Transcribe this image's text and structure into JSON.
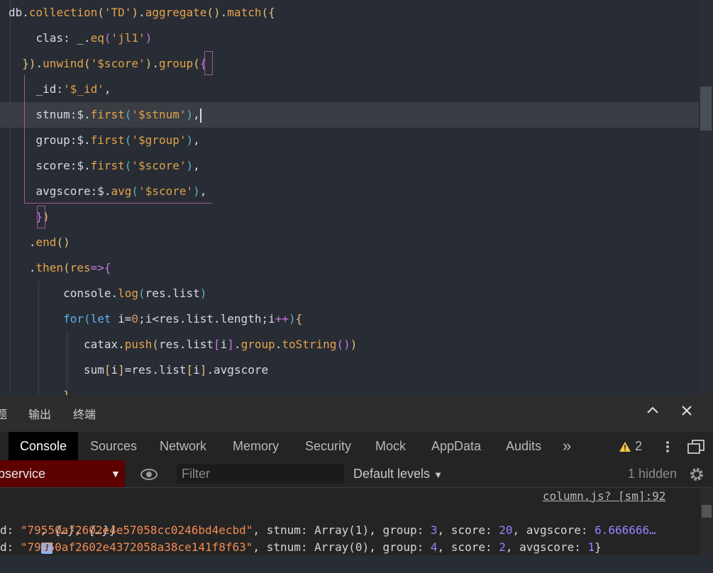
{
  "editor": {
    "lines": [
      [
        [
          "t-plain",
          "db."
        ],
        [
          "t-fn",
          "collection"
        ],
        [
          "t-br1",
          "("
        ],
        [
          "t-str",
          "'TD'"
        ],
        [
          "t-br1",
          ")"
        ],
        [
          "t-plain",
          "."
        ],
        [
          "t-fn",
          "aggregate"
        ],
        [
          "t-br1",
          "()"
        ],
        [
          "t-plain",
          "."
        ],
        [
          "t-fn",
          "match"
        ],
        [
          "t-br1",
          "({"
        ]
      ],
      [
        [
          "t-plain",
          "    clas: _."
        ],
        [
          "t-fn",
          "eq"
        ],
        [
          "t-br2",
          "("
        ],
        [
          "t-str",
          "'jl1'"
        ],
        [
          "t-br2",
          ")"
        ]
      ],
      [
        [
          "t-plain",
          "  "
        ],
        [
          "t-br1",
          "})"
        ],
        [
          "t-plain",
          "."
        ],
        [
          "t-fn",
          "unwind"
        ],
        [
          "t-br1",
          "("
        ],
        [
          "t-str",
          "'$score'"
        ],
        [
          "t-br1",
          ")"
        ],
        [
          "t-plain",
          "."
        ],
        [
          "t-fn",
          "group"
        ],
        [
          "t-br1",
          "("
        ],
        [
          "t-br2",
          "{"
        ]
      ],
      [
        [
          "t-plain",
          "    _id:"
        ],
        [
          "t-str",
          "'$_id'"
        ],
        [
          "t-plain",
          ","
        ]
      ],
      [
        [
          "t-plain",
          "    stnum:$."
        ],
        [
          "t-fn",
          "first"
        ],
        [
          "t-br3",
          "("
        ],
        [
          "t-str",
          "'$stnum'"
        ],
        [
          "t-br3",
          ")"
        ],
        [
          "t-plain",
          ","
        ]
      ],
      [
        [
          "t-plain",
          "    group:$."
        ],
        [
          "t-fn",
          "first"
        ],
        [
          "t-br3",
          "("
        ],
        [
          "t-str",
          "'$group'"
        ],
        [
          "t-br3",
          ")"
        ],
        [
          "t-plain",
          ","
        ]
      ],
      [
        [
          "t-plain",
          "    score:$."
        ],
        [
          "t-fn",
          "first"
        ],
        [
          "t-br3",
          "("
        ],
        [
          "t-str",
          "'$score'"
        ],
        [
          "t-br3",
          ")"
        ],
        [
          "t-plain",
          ","
        ]
      ],
      [
        [
          "t-plain",
          "    avgscore:$."
        ],
        [
          "t-fn",
          "avg"
        ],
        [
          "t-br3",
          "("
        ],
        [
          "t-str",
          "'$score'"
        ],
        [
          "t-br3",
          ")"
        ],
        [
          "t-plain",
          ","
        ]
      ],
      [
        [
          "t-plain",
          "    "
        ],
        [
          "t-br2",
          "}"
        ],
        [
          "t-br1",
          ")"
        ]
      ],
      [
        [
          "t-plain",
          "   ."
        ],
        [
          "t-fn",
          "end"
        ],
        [
          "t-br1",
          "()"
        ]
      ],
      [
        [
          "t-plain",
          "   ."
        ],
        [
          "t-fn",
          "then"
        ],
        [
          "t-br1",
          "("
        ],
        [
          "t-fn",
          "res"
        ],
        [
          "t-pink",
          "=>"
        ],
        [
          "t-br2",
          "{"
        ]
      ],
      [
        [
          "t-plain",
          "        console."
        ],
        [
          "t-fn",
          "log"
        ],
        [
          "t-br3",
          "("
        ],
        [
          "t-plain",
          "res.list"
        ],
        [
          "t-br3",
          ")"
        ]
      ],
      [
        [
          "t-plain",
          "        "
        ],
        [
          "t-kw",
          "for"
        ],
        [
          "t-br3",
          "("
        ],
        [
          "t-kw",
          "let"
        ],
        [
          "t-plain",
          " i="
        ],
        [
          "t-num",
          "0"
        ],
        [
          "t-plain",
          ";i<res.list.length;i"
        ],
        [
          "t-pink",
          "++"
        ],
        [
          "t-br3",
          ")"
        ],
        [
          "t-br1",
          "{"
        ]
      ],
      [
        [
          "t-plain",
          "           catax."
        ],
        [
          "t-fn",
          "push"
        ],
        [
          "t-br1",
          "("
        ],
        [
          "t-plain",
          "res.list"
        ],
        [
          "t-br2",
          "["
        ],
        [
          "t-plain",
          "i"
        ],
        [
          "t-br2",
          "]"
        ],
        [
          "t-plain",
          "."
        ],
        [
          "t-fn",
          "group"
        ],
        [
          "t-plain",
          "."
        ],
        [
          "t-fn",
          "toString"
        ],
        [
          "t-br2",
          "()"
        ],
        [
          "t-br1",
          ")"
        ]
      ],
      [
        [
          "t-plain",
          "           sum"
        ],
        [
          "t-br1",
          "["
        ],
        [
          "t-plain",
          "i"
        ],
        [
          "t-br1",
          "]"
        ],
        [
          "t-plain",
          "=res.list"
        ],
        [
          "t-br1",
          "["
        ],
        [
          "t-plain",
          "i"
        ],
        [
          "t-br1",
          "]"
        ],
        [
          "t-plain",
          ".avgscore"
        ]
      ],
      [
        [
          "t-plain",
          "        "
        ],
        [
          "t-br1",
          "}"
        ]
      ]
    ]
  },
  "panel": {
    "tabs": [
      "题",
      "输出",
      "终端"
    ],
    "collapse_icon": "chevron-up-icon",
    "close_icon": "close-icon"
  },
  "devtools": {
    "tabs": [
      "Console",
      "Sources",
      "Network",
      "Memory",
      "Security",
      "Mock",
      "AppData",
      "Audits"
    ],
    "more_label": "»",
    "warnings_count": "2",
    "context": "bservice",
    "filter_placeholder": "Filter",
    "levels": "Default levels",
    "hidden": "1 hidden"
  },
  "console": {
    "source_link": "column.js? [sm]:92",
    "summary": ", {…}, {…}]",
    "rows": [
      {
        "prefix": "d: ",
        "id": "\"79550af2602e4e57058cc0246bd4ecbd\"",
        "stnum": "Array(1)",
        "group": "3",
        "score": "20",
        "avgscore": "6.666666…",
        "tail": ""
      },
      {
        "prefix": "d: ",
        "id": "\"79550af2602e4372058a38ce141f8f63\"",
        "stnum": "Array(0)",
        "group": "4",
        "score": "2",
        "avgscore": "1",
        "tail": "}"
      }
    ]
  },
  "colors": {
    "editor_bg": "#282c34",
    "panel_bg": "#242424",
    "context_bg": "#5c0000",
    "string_orange": "#f28b54",
    "number_purple": "#9980ff"
  }
}
